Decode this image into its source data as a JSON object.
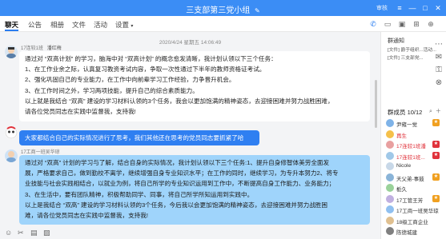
{
  "window": {
    "title": "三支部第三党小组",
    "title_icon": "edit-pencil-icon",
    "user": "审核"
  },
  "tabs": [
    {
      "label": "聊天",
      "active": true
    },
    {
      "label": "公告"
    },
    {
      "label": "相册"
    },
    {
      "label": "文件"
    },
    {
      "label": "活动"
    },
    {
      "label": "设置"
    }
  ],
  "chat": {
    "timestamp": "2020/4/24 星期五 14:06:49",
    "messages": [
      {
        "sender": "17连较1班",
        "badge": "潘红梅",
        "style": "white",
        "lines": [
          "通过对 “双高计划” 的学习，脑海中对 “双高计划” 的概念愈发清晰，我计划认领以下三个任务：",
          "1、在工作业余之际，认真复习教资考试内容，争取一次性通过下半年的教师资格证考试。",
          "2、强化巩固自己的专业能力，在工作中向前辈学习工作经验，力争晋升机会。",
          "3、在工作时间之外，学习两项技能，提升自己的综合素质能力。",
          "以上就是我结合 “双高” 建设的学习材料认领的3个任务，我会以更加饱满的精神姿态，去迎接困难并努力战胜困难，",
          "请各位党员同志在实践中监督我，支持我!"
        ]
      },
      {
        "sender": "",
        "style": "blue",
        "lines": [
          "大家都结合自己的实际情况进行了思考，我们其他还在思考的党员同志要抓紧了哈"
        ]
      },
      {
        "sender": "17工商一班吴华琼",
        "badge": "",
        "style": "lightblue",
        "lines": [
          "通过对 “双高” 计划的学习与了解，结合自身的实际情况，我计划认领以下三个任务:1、提升自身修智体美劳全面发",
          "展，严格要求自己，做到勤校不离学，继续增强自身专业知识水平；在工作的同时，继续学习，为专升本努力2、将专",
          "业技能与社会实践相结合，以就业为例，将自己所学的专业知识运用到工作中，不断提高自身工作能力、业务能力；",
          "3、在生活中，要有团队精神，积极帮助同学、同事，将自己所学所知运用到实践中。",
          "以上是我结合 “双高” 建设的学习材料认领的3个任务，今后我以会更加饱满的精神姿态，去迎接困难并努力战胜困",
          "难，请各位党员同志在实践中监督我，支持我!"
        ]
      }
    ]
  },
  "right_panel": {
    "notice_title": "群通知",
    "files": [
      {
        "tag": "[文件]",
        "name": "爵于组织...活动..."
      },
      {
        "tag": "[文件]",
        "name": "三支部党..."
      }
    ],
    "members_title": "群成员 10/12",
    "members": [
      {
        "name": "尹雍一觉",
        "color": "#333333",
        "avatar": "#7fb3e8",
        "tag": "#f0a020"
      },
      {
        "name": "再生",
        "color": "#e0323b",
        "avatar": "#f5c04a",
        "tag": ""
      },
      {
        "name": "17连较1班潘",
        "color": "#e0323b",
        "avatar": "#e8a0a0",
        "tag": "#e0323b"
      },
      {
        "name": "17连较1班...",
        "color": "#e0323b",
        "avatar": "#a0c8e8",
        "tag": "#e0323b"
      },
      {
        "name": "Nicole",
        "color": "#333333",
        "avatar": "#c8d8e8",
        "tag": ""
      },
      {
        "name": "天父弟-事鼓",
        "color": "#333333",
        "avatar": "#8ab4d8",
        "tag": "#f0a020"
      },
      {
        "name": "栀久",
        "color": "#333333",
        "avatar": "#9ad29a",
        "tag": ""
      },
      {
        "name": "17工管王芳",
        "color": "#333333",
        "avatar": "#c0b0e0",
        "tag": "#f0a020"
      },
      {
        "name": "17工商一班吴华琼",
        "color": "#333333",
        "avatar": "#90c0f0",
        "tag": ""
      },
      {
        "name": "18级工商企业",
        "color": "#333333",
        "avatar": "#e0c090",
        "tag": ""
      },
      {
        "name": "陈德城建",
        "color": "#333333",
        "avatar": "#808080",
        "tag": ""
      }
    ]
  }
}
